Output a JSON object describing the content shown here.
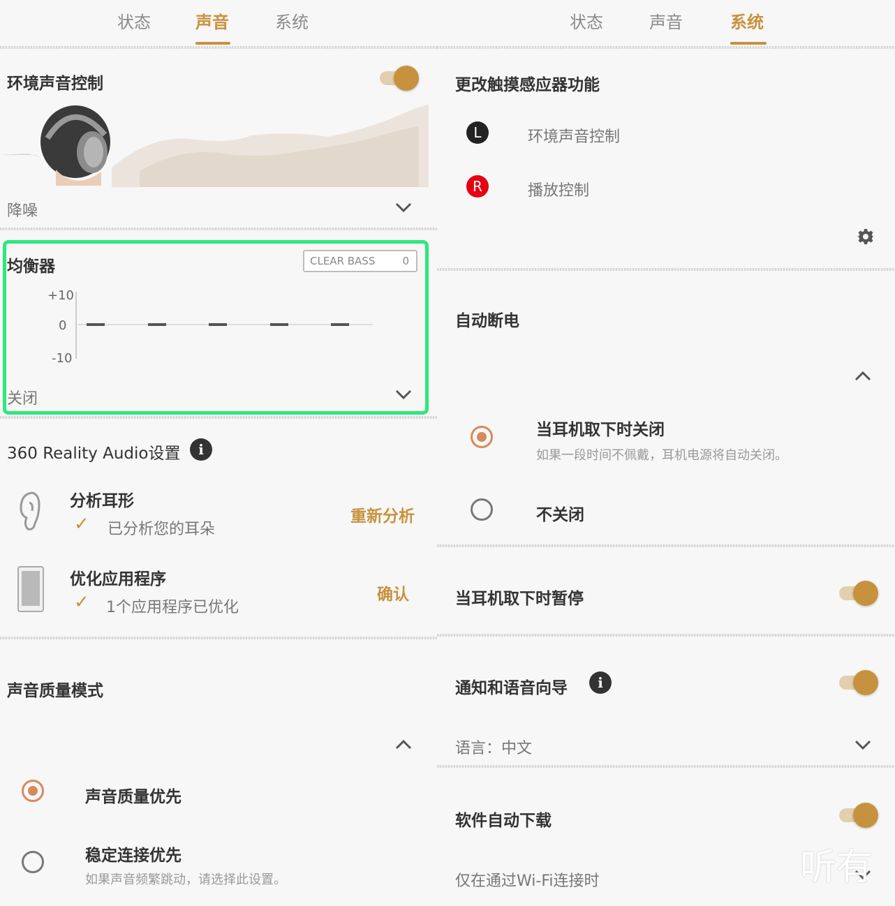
{
  "left_panel": {
    "tabs": [
      {
        "label": "状态"
      },
      {
        "label": "声音"
      },
      {
        "label": "系统"
      }
    ],
    "ambient": {
      "title": "环境声音控制",
      "mode_label": "降噪"
    },
    "equalizer": {
      "title": "均衡器",
      "clear_bass_label": "CLEAR BASS",
      "clear_bass_value": "0",
      "axis_top": "+10",
      "axis_mid": "0",
      "axis_bottom": "-10",
      "band_levels": [
        0,
        0,
        0,
        0,
        0
      ],
      "preset_label": "关闭"
    },
    "reality_audio": {
      "title": "360 Reality Audio设置",
      "info_icon": "i",
      "ear": {
        "title": "分析耳形",
        "status": "已分析您的耳朵",
        "action": "重新分析"
      },
      "apps": {
        "title": "优化应用程序",
        "status": "1个应用程序已优化",
        "action": "确认"
      }
    },
    "quality": {
      "title": "声音质量模式",
      "options": [
        {
          "label": "声音质量优先",
          "selected": true
        },
        {
          "label": "稳定连接优先",
          "desc": "如果声音频繁跳动，请选择此设置。",
          "selected": false
        }
      ]
    }
  },
  "right_panel": {
    "tabs": [
      {
        "label": "状态"
      },
      {
        "label": "声音"
      },
      {
        "label": "系统"
      }
    ],
    "touch": {
      "title": "更改触摸感应器功能",
      "left_badge": "L",
      "left_label": "环境声音控制",
      "right_badge": "R",
      "right_label": "播放控制"
    },
    "auto_off": {
      "title": "自动断电",
      "options": [
        {
          "label": "当耳机取下时关闭",
          "desc": "如果一段时间不佩戴，耳机电源将自动关闭。",
          "selected": true
        },
        {
          "label": "不关闭",
          "selected": false
        }
      ]
    },
    "pause": {
      "title": "当耳机取下时暂停",
      "on": true
    },
    "voice_guide": {
      "title": "通知和语音向导",
      "info_icon": "i",
      "on": true,
      "language": "语言：中文"
    },
    "auto_download": {
      "title": "软件自动下载",
      "on": true,
      "desc": "仅在通过Wi-Fi连接时"
    }
  },
  "watermark": "听有"
}
